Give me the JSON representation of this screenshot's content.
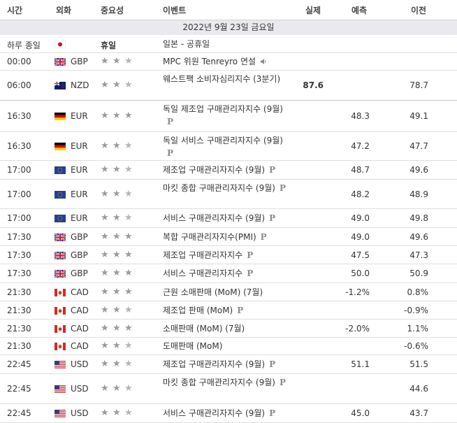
{
  "header": {
    "time": "시간",
    "currency": "외화",
    "importance": "중요성",
    "event": "이벤트",
    "actual": "실제",
    "forecast": "예측",
    "previous": "이전"
  },
  "date_label": "2022년 9월 23일 금요일",
  "rows": [
    {
      "time": "하루 종일",
      "flag": "japan-flag",
      "currency": "",
      "importance": "휴일",
      "event": "일본 - 공휴일",
      "actual": "",
      "forecast": "",
      "previous": ""
    },
    {
      "time": "00:00",
      "flag": "uk-flag",
      "currency": "GBP",
      "importance": 2,
      "event": "MPC 위원 Tenreyro 연설",
      "actual": "",
      "forecast": "",
      "previous": "",
      "speech": true
    },
    {
      "time": "06:00",
      "flag": "new-zealand-flag",
      "currency": "NZD",
      "importance": 2,
      "event": "웨스트팩 소비자심리지수 (3분기)",
      "actual": "87.6",
      "forecast": "",
      "previous": "78.7"
    },
    {
      "time": "16:30",
      "flag": "germany-flag",
      "currency": "EUR",
      "importance": 3,
      "event": "독일 제조업 구매관리자지수 (9월)",
      "actual": "",
      "forecast": "48.3",
      "previous": "49.1",
      "prelim": true
    },
    {
      "time": "16:30",
      "flag": "germany-flag",
      "currency": "EUR",
      "importance": 2,
      "event": "독일 서비스 구매관리자지수 (9월)",
      "actual": "",
      "forecast": "47.2",
      "previous": "47.7",
      "prelim": true
    },
    {
      "time": "17:00",
      "flag": "eu-flag",
      "currency": "EUR",
      "importance": 2,
      "event": "제조업 구매관리자지수 (9월)",
      "actual": "",
      "forecast": "48.7",
      "previous": "49.6",
      "prelim": true
    },
    {
      "time": "17:00",
      "flag": "eu-flag",
      "currency": "EUR",
      "importance": 2,
      "event": "마킷 종합 구매관리자지수 (9월)",
      "actual": "",
      "forecast": "48.2",
      "previous": "48.9",
      "prelim": true
    },
    {
      "time": "17:00",
      "flag": "eu-flag",
      "currency": "EUR",
      "importance": 2,
      "event": "서비스 구매관리자지수 (9월)",
      "actual": "",
      "forecast": "49.0",
      "previous": "49.8",
      "prelim": true
    },
    {
      "time": "17:30",
      "flag": "uk-flag",
      "currency": "GBP",
      "importance": 3,
      "event": "복합 구매관리자지수(PMI)",
      "actual": "",
      "forecast": "49.0",
      "previous": "49.6",
      "prelim": true
    },
    {
      "time": "17:30",
      "flag": "uk-flag",
      "currency": "GBP",
      "importance": 3,
      "event": "제조업 구매관리자지수",
      "actual": "",
      "forecast": "47.5",
      "previous": "47.3",
      "prelim": true
    },
    {
      "time": "17:30",
      "flag": "uk-flag",
      "currency": "GBP",
      "importance": 3,
      "event": "서비스 구매관리자지수",
      "actual": "",
      "forecast": "50.0",
      "previous": "50.9",
      "prelim": true
    },
    {
      "time": "21:30",
      "flag": "canada-flag",
      "currency": "CAD",
      "importance": 3,
      "event": "근원 소매판매 (MoM) (7월)",
      "actual": "",
      "forecast": "-1.2%",
      "previous": "0.8%"
    },
    {
      "time": "21:30",
      "flag": "canada-flag",
      "currency": "CAD",
      "importance": 2,
      "event": "제조업 판매 (MoM)",
      "actual": "",
      "forecast": "",
      "previous": "-0.9%",
      "prelim": true
    },
    {
      "time": "21:30",
      "flag": "canada-flag",
      "currency": "CAD",
      "importance": 3,
      "event": "소매판매 (MoM) (7월)",
      "actual": "",
      "forecast": "-2.0%",
      "previous": "1.1%"
    },
    {
      "time": "21:30",
      "flag": "canada-flag",
      "currency": "CAD",
      "importance": 2,
      "event": "도매판매 (MoM)",
      "actual": "",
      "forecast": "",
      "previous": "-0.6%"
    },
    {
      "time": "22:45",
      "flag": "usa-flag",
      "currency": "USD",
      "importance": 2,
      "event": "제조업 구매관리자지수 (9월)",
      "actual": "",
      "forecast": "51.1",
      "previous": "51.5",
      "prelim": true
    },
    {
      "time": "22:45",
      "flag": "usa-flag",
      "currency": "USD",
      "importance": 2,
      "event": "마킷 종합 구매관리자지수 (9월)",
      "actual": "",
      "forecast": "",
      "previous": "44.6",
      "prelim": true
    },
    {
      "time": "22:45",
      "flag": "usa-flag",
      "currency": "USD",
      "importance": 2,
      "event": "서비스 구매관리자지수 (9월)",
      "actual": "",
      "forecast": "45.0",
      "previous": "43.7",
      "prelim": true
    }
  ],
  "prelim_mark": "P",
  "star_glyph": "★",
  "colors": {
    "header_bg": "#e9e9ee",
    "border": "#d4d4d4",
    "star_on": "#9a9a9a",
    "star_off": "#b5b5b5"
  }
}
